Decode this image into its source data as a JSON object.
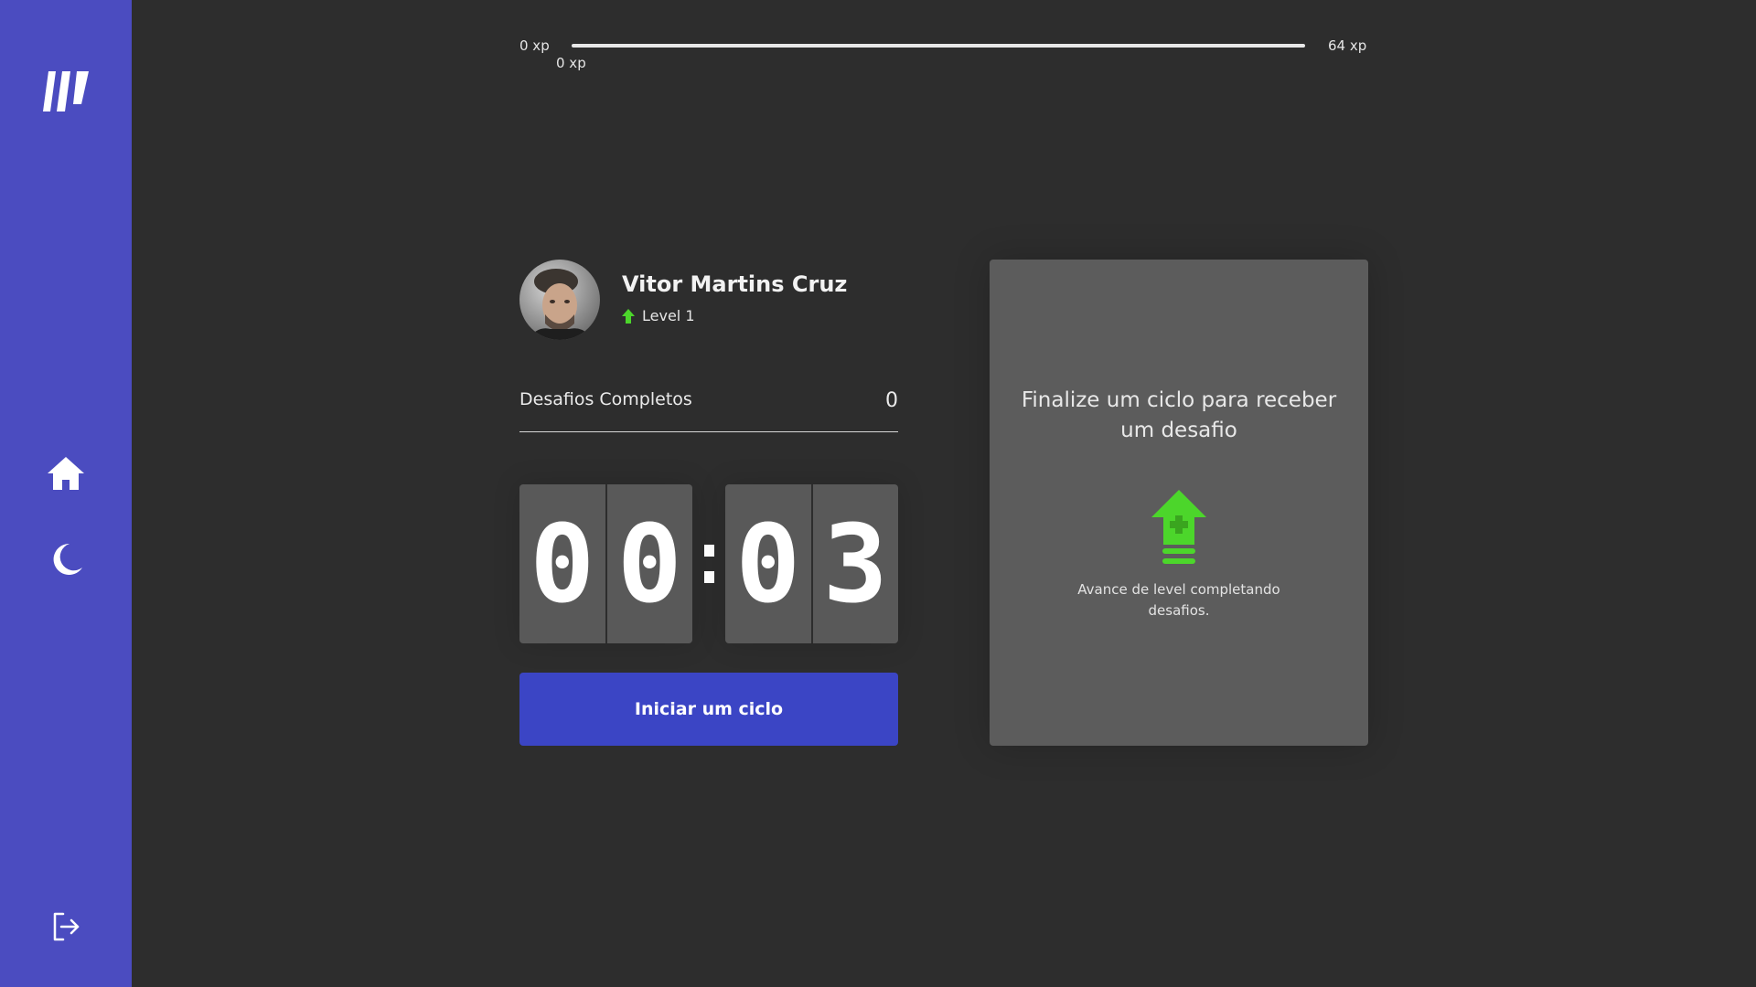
{
  "sidebar": {
    "logo_icon": "brand-logo",
    "items": [
      {
        "icon": "home-icon"
      },
      {
        "icon": "moon-icon"
      }
    ],
    "logout_icon": "logout-icon"
  },
  "experience": {
    "min_label": "0 xp",
    "max_label": "64 xp",
    "current_label": "0 xp",
    "progress_fraction": 0
  },
  "profile": {
    "name": "Vitor Martins Cruz",
    "level_label": "Level 1"
  },
  "completed_challenges": {
    "label": "Desafios Completos",
    "value": "0"
  },
  "countdown": {
    "minute_left": "0",
    "minute_right": "0",
    "second_left": "0",
    "second_right": "3"
  },
  "start_button": {
    "label": "Iniciar um ciclo"
  },
  "challenge_box": {
    "title": "Finalize um ciclo para receber um desafio",
    "description": "Avance de level completando desafios.",
    "icon": "level-up-icon"
  },
  "colors": {
    "sidebar": "#4b4cc0",
    "background": "#2d2d2d",
    "accent_green": "#4cd62b",
    "button_blue": "#3b45c5",
    "card": "#5c5c5c"
  }
}
